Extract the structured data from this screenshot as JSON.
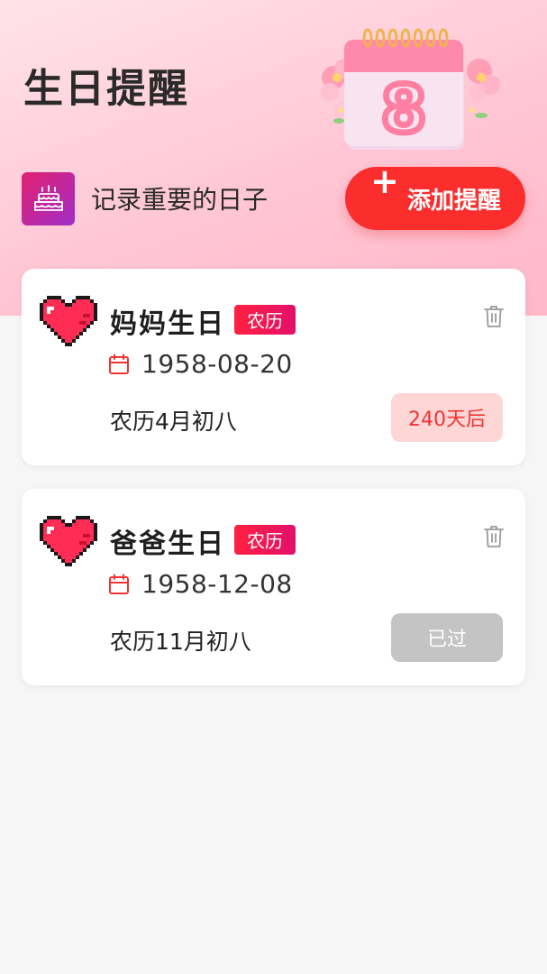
{
  "header": {
    "title": "生日提醒",
    "subtitle": "记录重要的日子",
    "add_button_label": "添加提醒",
    "calendar_decoration_number": "8"
  },
  "icons": {
    "cake": "cake-icon",
    "plus": "plus-icon",
    "heart": "pixel-heart-icon",
    "trash": "trash-icon",
    "calendar": "calendar-icon"
  },
  "colors": {
    "accent_red": "#fc2d2d",
    "badge_gradient_start": "#ff2040",
    "badge_gradient_end": "#e3106a",
    "upcoming_bg": "#ffd6d6",
    "upcoming_text": "#f03434",
    "past_bg": "#c4c4c4"
  },
  "reminders": [
    {
      "name": "妈妈生日",
      "badge": "农历",
      "date": "1958-08-20",
      "lunar_date": "农历4月初八",
      "status": "240天后",
      "status_type": "upcoming"
    },
    {
      "name": "爸爸生日",
      "badge": "农历",
      "date": "1958-12-08",
      "lunar_date": "农历11月初八",
      "status": "已过",
      "status_type": "past"
    }
  ]
}
